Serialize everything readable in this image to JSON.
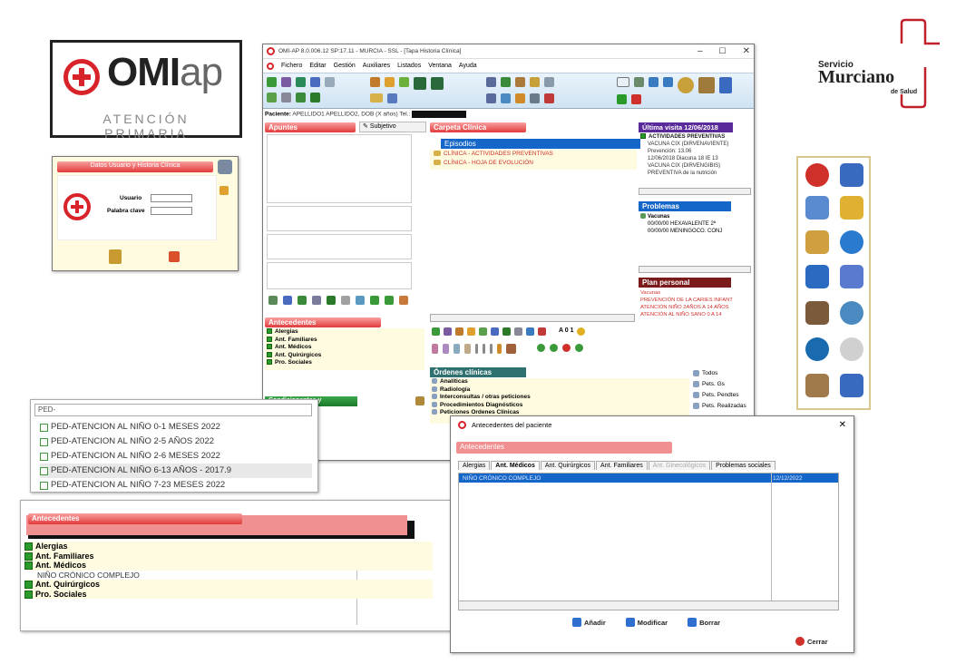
{
  "logo": {
    "brand_bold": "OMI",
    "brand_light": "ap",
    "subtitle": "ATENCIÓN PRIMARIA"
  },
  "sms_logo": {
    "line1": "Servicio",
    "line2": "Murciano",
    "line3": "de Salud"
  },
  "login": {
    "title": "Datos Usuario y Historia Clínica",
    "user_label": "Usuario",
    "pass_label": "Palabra clave"
  },
  "main": {
    "title": "OMI-AP 8.0.006.12 SP:17.11 - MURCIA - SSL - [Tapa Historia Clínica]",
    "menu": [
      "Fichero",
      "Editar",
      "Gestión",
      "Auxiliares",
      "Listados",
      "Ventana",
      "Ayuda"
    ],
    "patient_label": "Paciente:",
    "patient_value": "APELLIDO1 APELLIDO2, DOB (X años) Tel.:",
    "apuntes_label": "Apuntes",
    "subjetivo_label": "Subjetivo",
    "carpeta_label": "Carpeta Clínica",
    "carpeta_selected": "Episodios",
    "carpeta_items": [
      "CLÍNICA - ACTIVIDADES PREVENTIVAS",
      "CLÍNICA - HOJA DE EVOLUCIÓN"
    ],
    "ultima_visita_label": "Última visita 12/06/2018",
    "ultima_visita_items": [
      "ACTIVIDADES PREVENTIVAS",
      "VACUNA CIX (DIRVENAVIENTE)",
      "Prevención: 13.06",
      "12/06/2018 Diacuna 18 IE 13",
      "VACUNA CIX (DIRVENGIBIS)",
      "PREVENTIVA de la nutrición"
    ],
    "problemas_label": "Problemas",
    "problemas_items": [
      "Vacunas",
      "00/00/00 HEXAVALENTE 2ª",
      "00/00/00 MENINGOCO. CONJ"
    ],
    "plan_label": "Plan personal",
    "plan_items": [
      "Vacunas",
      "PREVENCIÓN DE LA CARIES INFANT",
      "ATENCIÓN NIÑO 2AÑOS A 14 AÑOS",
      "ATENCIÓN AL NIÑO SANO 0 A 14"
    ],
    "antecedentes_label": "Antecedentes",
    "antecedentes_items": [
      "Alergias",
      "Ant. Familiares",
      "Ant. Médicos",
      "Ant. Quirúrgicos",
      "Pro. Sociales"
    ],
    "condicionantes_label": "Condicionantes y problemas",
    "ordenes_label": "Órdenes clínicas",
    "ordenes_items": [
      "Analíticas",
      "Radiología",
      "Interconsultas / otras peticiones",
      "Procedimientos Diagnósticos",
      "Peticiones Ordenes Clínicas"
    ],
    "right_list": [
      "Todos",
      "Pets. Gs",
      "Pets. Pendtes",
      "Pets. Realizadas"
    ],
    "calc": "A 0 1"
  },
  "ped_list": {
    "header": "PED-",
    "items": [
      "PED-ATENCION AL NIÑO 0-1 MESES 2022",
      "PED-ATENCION AL NIÑO 2-5 AÑOS 2022",
      "PED-ATENCION AL NIÑO 2-6 MESES 2022",
      "PED-ATENCION AL NIÑO 6-13 AÑOS - 2017.9",
      "PED-ATENCION AL NIÑO 7-23 MESES 2022"
    ]
  },
  "ant_big": {
    "header": "Antecedentes",
    "items": [
      "Alergias",
      "Ant. Familiares",
      "Ant. Médicos",
      "NIÑO CRÓNICO COMPLEJO",
      "Ant. Quirúrgicos",
      "Pro. Sociales"
    ]
  },
  "dialog": {
    "title": "Antecedentes del paciente",
    "header": "Antecedentes",
    "tabs": [
      "Alergias",
      "Ant. Médicos",
      "Ant. Quirúrgicos",
      "Ant. Familiares",
      "Ant. Ginecológicos",
      "Problemas sociales"
    ],
    "row_text": "NIÑO CRÓNICO COMPLEJO",
    "row_date": "12/12/2022",
    "add": "Añadir",
    "modify": "Modificar",
    "delete": "Borrar",
    "close": "Cerrar"
  },
  "colors": {
    "omi_red": "#d9232a",
    "sms_red": "#c0202a",
    "selection_blue": "#1466c8"
  }
}
